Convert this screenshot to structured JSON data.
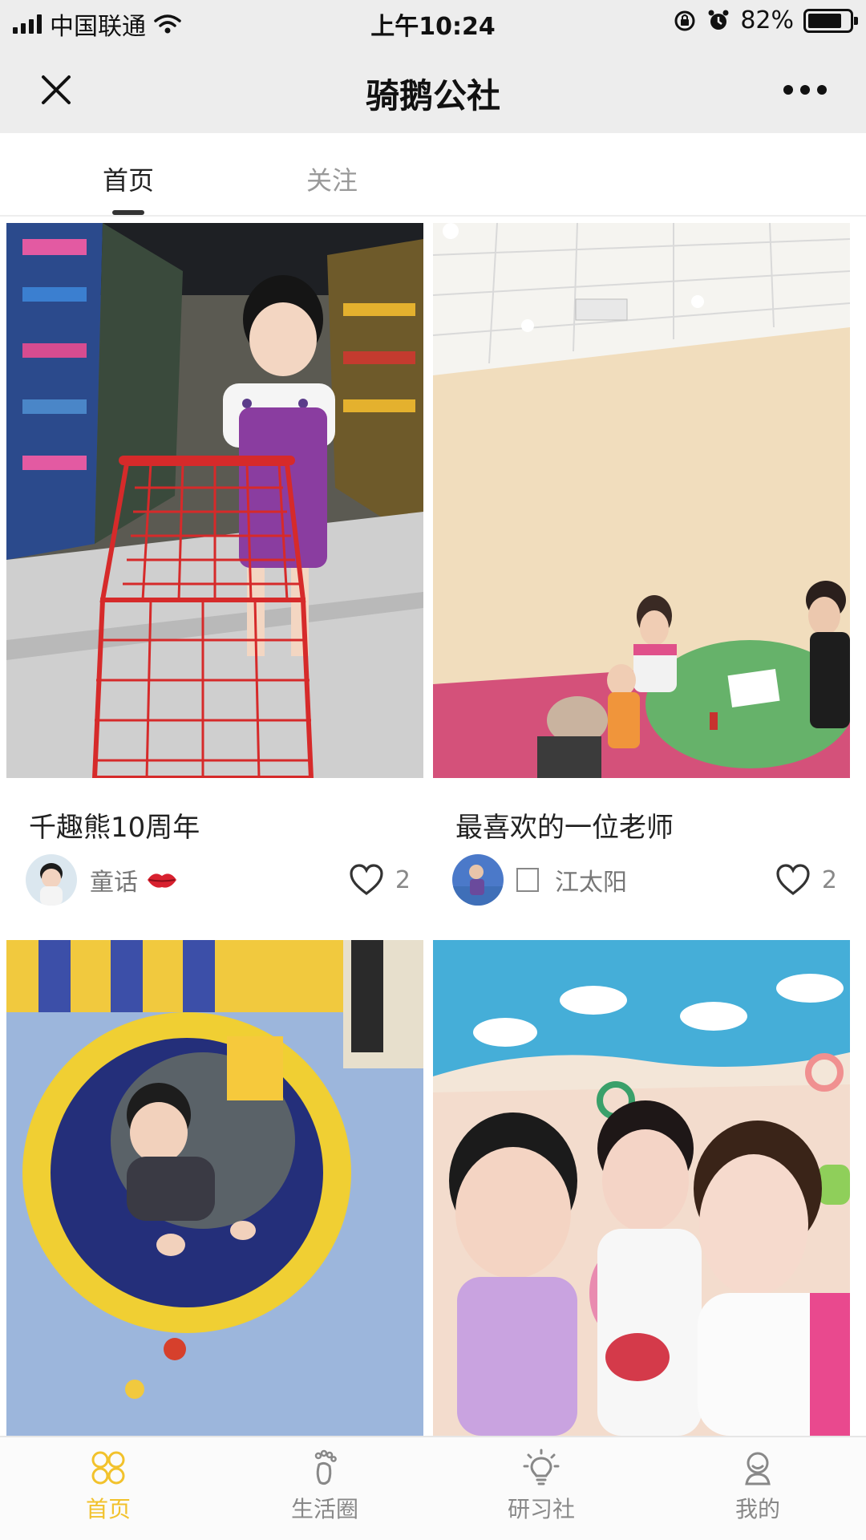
{
  "status_bar": {
    "carrier": "中国联通",
    "time": "上午10:24",
    "battery": "82%",
    "battery_level": 0.82
  },
  "nav": {
    "title": "骑鹅公社"
  },
  "tabs": [
    {
      "label": "首页",
      "active": true
    },
    {
      "label": "关注",
      "active": false
    }
  ],
  "feed": [
    {
      "title": "千趣熊10周年",
      "author": "童话",
      "likes": "2",
      "image": "child-with-shopping-cart-photo"
    },
    {
      "title": "最喜欢的一位老师",
      "author": "江太阳",
      "likes": "2",
      "image": "classroom-teacher-photo"
    },
    {
      "title": "",
      "author": "",
      "likes": "",
      "image": "child-in-play-tunnel-photo"
    },
    {
      "title": "",
      "author": "",
      "likes": "",
      "image": "teachers-and-child-selfie-photo"
    }
  ],
  "bottom_nav": [
    {
      "label": "首页",
      "icon": "home-grid-icon",
      "active": true
    },
    {
      "label": "生活圈",
      "icon": "footprint-icon",
      "active": false
    },
    {
      "label": "研习社",
      "icon": "lightbulb-icon",
      "active": false
    },
    {
      "label": "我的",
      "icon": "profile-icon",
      "active": false
    }
  ],
  "colors": {
    "accent": "#f2c22c",
    "nav_background": "#ededed"
  }
}
